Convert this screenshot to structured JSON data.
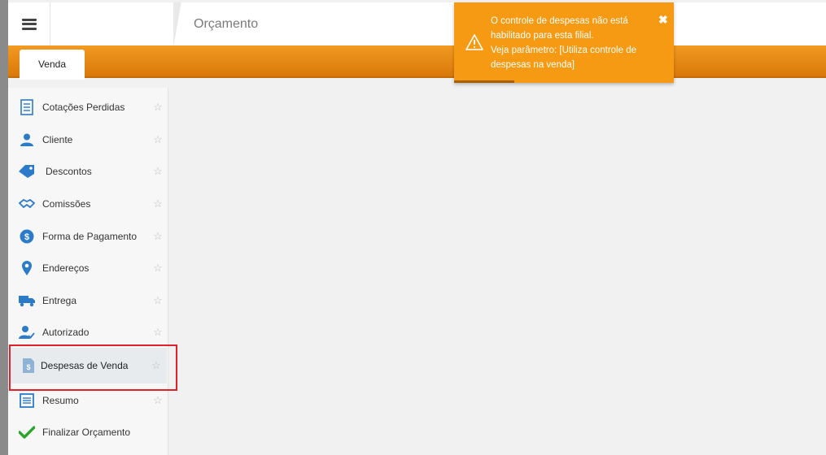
{
  "header": {
    "menu_icon": "hamburger-icon",
    "page_title": "Orçamento"
  },
  "tabs": [
    {
      "label": "Venda",
      "active": true
    }
  ],
  "sidebar": {
    "items": [
      {
        "label": "Cotações Perdidas",
        "icon": "list-icon"
      },
      {
        "label": "Cliente",
        "icon": "user-icon"
      },
      {
        "label": "Descontos",
        "icon": "tag-icon"
      },
      {
        "label": "Comissões",
        "icon": "handshake-icon"
      },
      {
        "label": "Forma de Pagamento",
        "icon": "dollar-icon"
      },
      {
        "label": "Endereços",
        "icon": "map-pin-icon"
      },
      {
        "label": "Entrega",
        "icon": "truck-icon"
      },
      {
        "label": "Autorizado",
        "icon": "user-check-icon"
      },
      {
        "label": "Despesas de Venda",
        "icon": "expense-doc-icon",
        "active": true
      },
      {
        "label": "Resumo",
        "icon": "document-icon"
      },
      {
        "label": "Finalizar Orçamento",
        "icon": "checkmark-icon"
      }
    ],
    "favorite_icon": "star-outline-icon"
  },
  "toast": {
    "icon": "warning-icon",
    "line1": "O controle de despesas não está",
    "line2": "habilitado para esta filial.",
    "line3": "Veja parâmetro: [Utiliza controle de",
    "line4": "despesas na venda]",
    "close_glyph": "✖",
    "color": "#f59a12"
  },
  "colors": {
    "accent_orange": "#e8880f",
    "highlight_red": "#e0202a",
    "icon_blue": "#2b7bc9",
    "check_green": "#2aa52a"
  }
}
